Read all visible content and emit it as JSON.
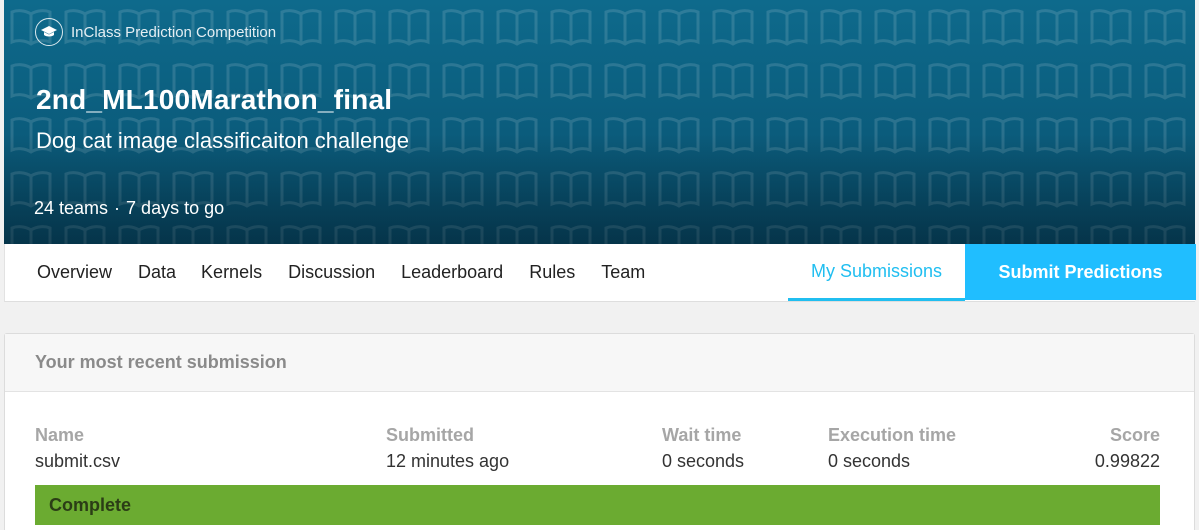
{
  "header": {
    "competition_type": "InClass Prediction Competition",
    "title": "2nd_ML100Marathon_final",
    "subtitle": "Dog cat image classificaiton challenge",
    "teams": "24 teams",
    "separator": "·",
    "deadline": "7 days to go",
    "icon": "graduation-cap-icon",
    "background_color": "#0b5c7c"
  },
  "tabs": {
    "overview": "Overview",
    "data": "Data",
    "kernels": "Kernels",
    "discussion": "Discussion",
    "leaderboard": "Leaderboard",
    "rules": "Rules",
    "team": "Team",
    "my_submissions": "My Submissions",
    "submit_predictions": "Submit Predictions",
    "accent_color": "#20beff"
  },
  "submission": {
    "heading": "Your most recent submission",
    "columns": {
      "name": "Name",
      "submitted": "Submitted",
      "wait_time": "Wait time",
      "execution_time": "Execution time",
      "score": "Score"
    },
    "values": {
      "name": "submit.csv",
      "submitted": "12 minutes ago",
      "wait_time": "0 seconds",
      "execution_time": "0 seconds",
      "score": "0.99822"
    },
    "status": "Complete",
    "status_color": "#6bab31"
  }
}
